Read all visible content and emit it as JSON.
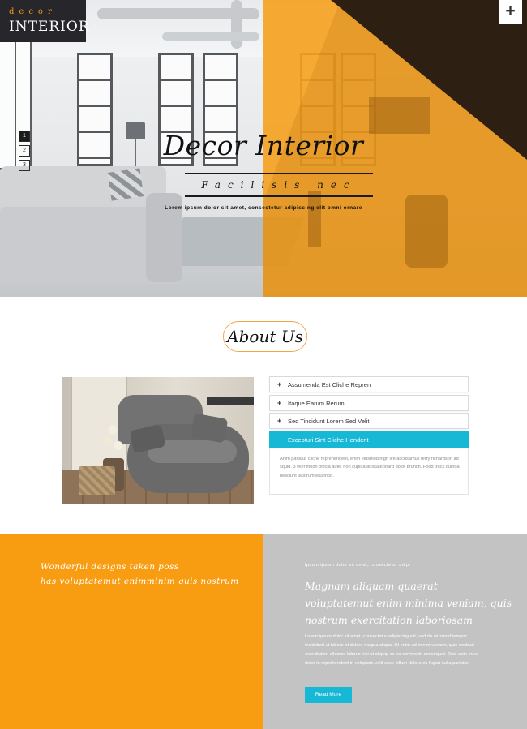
{
  "logo": {
    "small": "decor",
    "big": "INTERIOR"
  },
  "header": {
    "menu_plus": "+"
  },
  "slider": {
    "dots": [
      "1",
      "2",
      "3"
    ],
    "active": 0
  },
  "hero": {
    "title": "Decor Interior",
    "subtitle": "Facilisis nec",
    "description": "Lorem ipsum dolor sit amet, consectetur adipiscing elit omni ornare"
  },
  "about": {
    "title": "About Us",
    "accordion": [
      {
        "sign": "+",
        "label": "Assumenda Est Cliche Repren"
      },
      {
        "sign": "+",
        "label": "Itaque Earum Rerum"
      },
      {
        "sign": "+",
        "label": "Sed Tincidunt Lorem Sed Velit"
      },
      {
        "sign": "–",
        "label": "Excepturi Sint Cliche Henderit"
      }
    ],
    "open_panel_text": "Anim pariatur cliche reprehenderit, enim eiusmod high life accusamus terry richardson ad squid. 3 wolf moon officia aute, non cupidatat skateboard dolor brunch. Food truck quinoa nesciunt laborum eiusmod."
  },
  "bottom_left": {
    "line1": "Wonderful designs taken poss",
    "line2": "has voluptatemut enimminim quis nostrum"
  },
  "bottom_right": {
    "small": "Ipsum ipsum dolor sit amet, consectetur adipi",
    "head1": "Magnam aliquam quaerat",
    "head2": "voluptatemut enim minima veniam, quis",
    "head3": "nostrum exercitation laboriosam",
    "body": "Lorem ipsum dolor sit amet, consectetur adipiscing elit, sed do eiusmod tempor incididunt ut labore et dolore magna aliqua. Ut enim ad minim veniam, quis nostrud exercitation ullamco laboris nisi ut aliquip ex ea commodo consequat. Duis aute irure dolor in reprehenderit in voluptate velit esse cillum dolore eu fugiat nulla pariatur.",
    "button": "Read More"
  },
  "colors": {
    "orange": "#f89c12",
    "dark": "#2e1f13",
    "accent": "#16b8d6",
    "gray": "#c3c3c3"
  }
}
